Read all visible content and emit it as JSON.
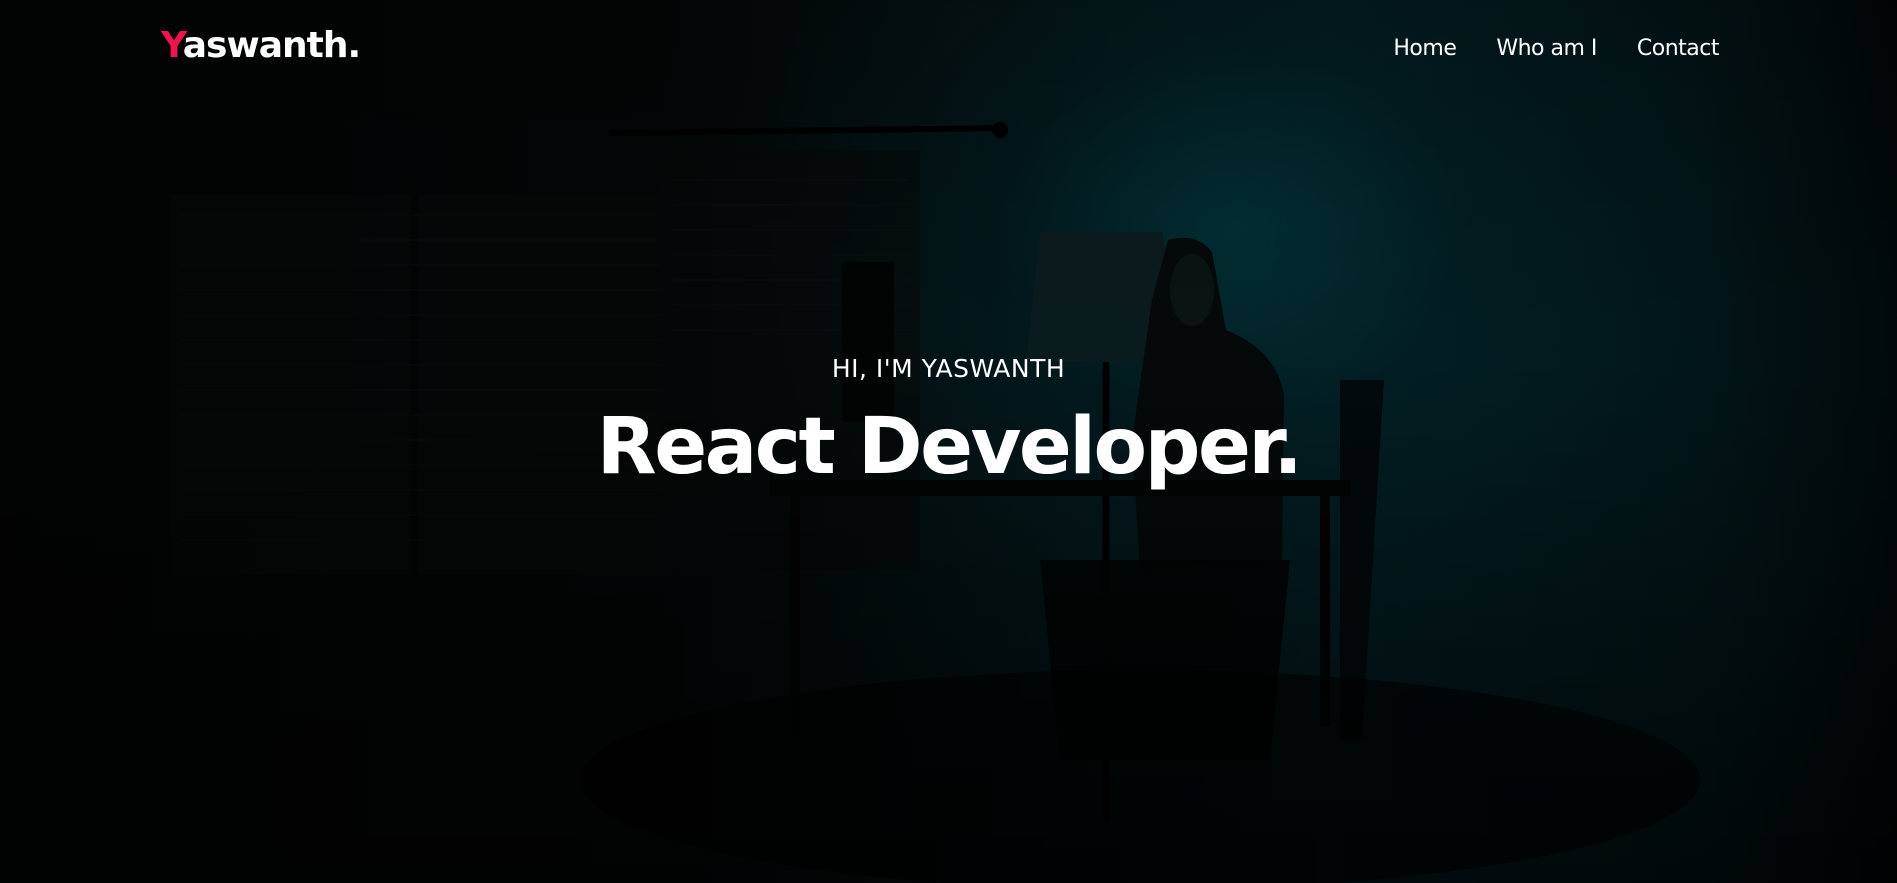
{
  "logo": {
    "first_letter": "Y",
    "rest": "aswanth.",
    "accent_color": "#f0134d"
  },
  "nav": {
    "items": [
      {
        "label": "Home"
      },
      {
        "label": "Who am I"
      },
      {
        "label": "Contact"
      }
    ]
  },
  "hero": {
    "intro": "HI, I'M YASWANTH",
    "headline": "React Developer."
  }
}
